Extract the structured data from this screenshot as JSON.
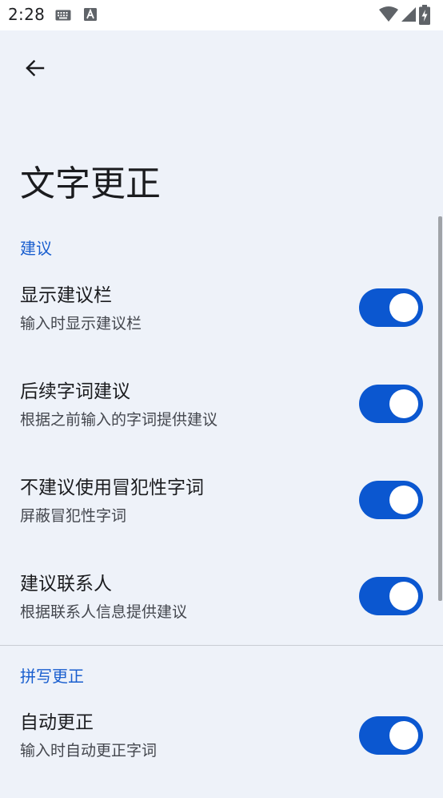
{
  "status_bar": {
    "time": "2:28",
    "icons": [
      "keyboard-icon",
      "a-icon",
      "wifi-icon",
      "signal-icon",
      "battery-charging-icon"
    ]
  },
  "header": {
    "back_icon": "arrow-back-icon",
    "title": "文字更正"
  },
  "sections": [
    {
      "header": "建议",
      "items": [
        {
          "title": "显示建议栏",
          "summary": "输入时显示建议栏",
          "checked": true
        },
        {
          "title": "后续字词建议",
          "summary": "根据之前输入的字词提供建议",
          "checked": true
        },
        {
          "title": "不建议使用冒犯性字词",
          "summary": "屏蔽冒犯性字词",
          "checked": true
        },
        {
          "title": "建议联系人",
          "summary": "根据联系人信息提供建议",
          "checked": true
        }
      ]
    },
    {
      "header": "拼写更正",
      "items": [
        {
          "title": "自动更正",
          "summary": "输入时自动更正字词",
          "checked": true
        }
      ]
    }
  ],
  "colors": {
    "accent": "#0b57d0",
    "section_header": "#1a5fcf",
    "background": "#eef2f9"
  }
}
